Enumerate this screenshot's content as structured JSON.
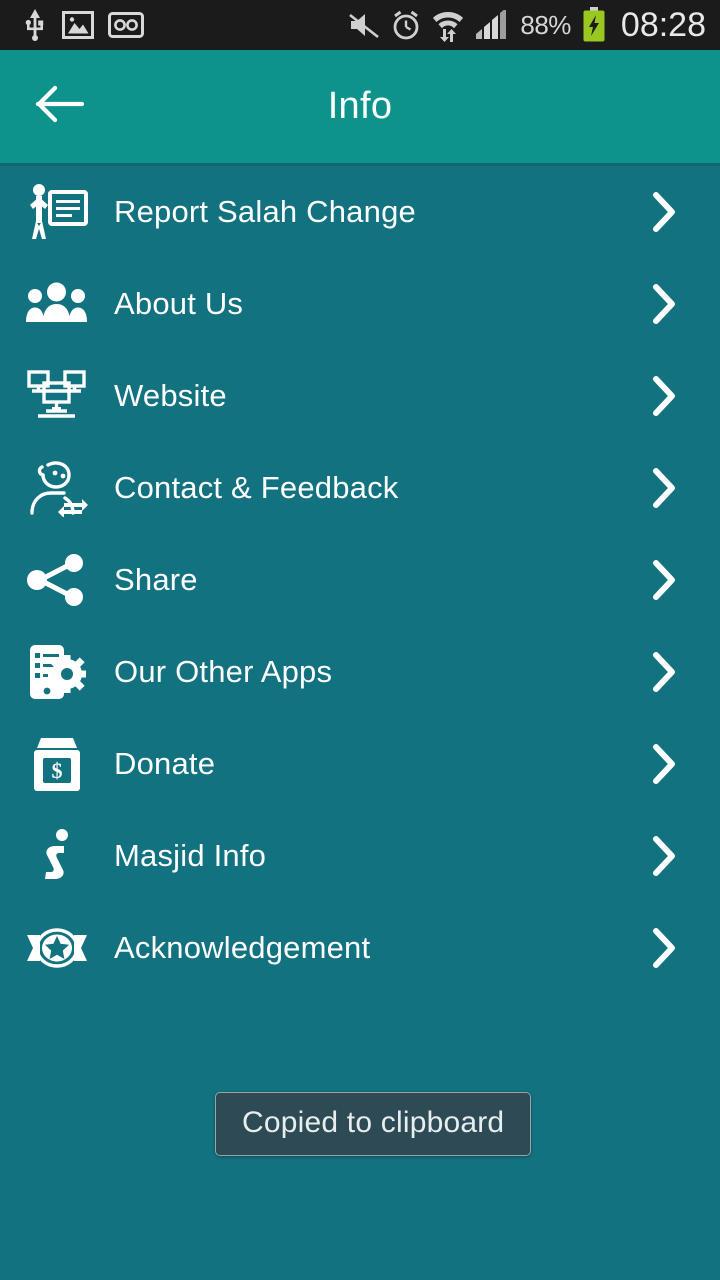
{
  "status_bar": {
    "background": "#1b1b1b",
    "left_icons": [
      {
        "name": "usb-icon",
        "label": "USB"
      },
      {
        "name": "screenshot-image-icon",
        "label": "Screenshot"
      },
      {
        "name": "voicemail-icon",
        "label": "Voicemail"
      }
    ],
    "right_icons": [
      {
        "name": "sound-muted-icon",
        "label": "Sound off"
      },
      {
        "name": "alarm-clock-icon",
        "label": "Alarm set"
      },
      {
        "name": "wifi-data-transfer-icon",
        "label": "Wi-Fi"
      },
      {
        "name": "cellular-signal-icon",
        "label": "Signal"
      }
    ],
    "battery_percent": "88%",
    "battery_state": "charging",
    "battery_color": "#9ac820",
    "clock": "08:28"
  },
  "appbar": {
    "title": "Info",
    "back_label": "Back",
    "background": "#0d938c",
    "text_color": "#ffffff"
  },
  "theme": {
    "body_background": "#13727F",
    "accent": "#0d938c",
    "label_color": "#fdfdfd",
    "chevron_color": "#ffffff"
  },
  "list": {
    "items": [
      {
        "label": "Report Salah Change",
        "icon": "presenter-board-icon",
        "chevron": "chevron-right-icon"
      },
      {
        "label": "About Us",
        "icon": "people-group-icon",
        "chevron": "chevron-right-icon"
      },
      {
        "label": "Website",
        "icon": "monitor-network-icon",
        "chevron": "chevron-right-icon"
      },
      {
        "label": "Contact & Feedback",
        "icon": "support-agent-icon",
        "chevron": "chevron-right-icon"
      },
      {
        "label": "Share",
        "icon": "share-nodes-icon",
        "chevron": "chevron-right-icon"
      },
      {
        "label": "Our Other Apps",
        "icon": "phone-gear-icon",
        "chevron": "chevron-right-icon"
      },
      {
        "label": "Donate",
        "icon": "donation-box-icon",
        "chevron": "chevron-right-icon"
      },
      {
        "label": "Masjid Info",
        "icon": "info-italic-icon",
        "chevron": "chevron-right-icon"
      },
      {
        "label": "Acknowledgement",
        "icon": "star-badge-icon",
        "chevron": "chevron-right-icon"
      }
    ]
  },
  "toast": {
    "message": "Copied to clipboard",
    "background": "#2e4a54",
    "border_color": "#95a7ad",
    "text_color": "#e6eef0"
  }
}
